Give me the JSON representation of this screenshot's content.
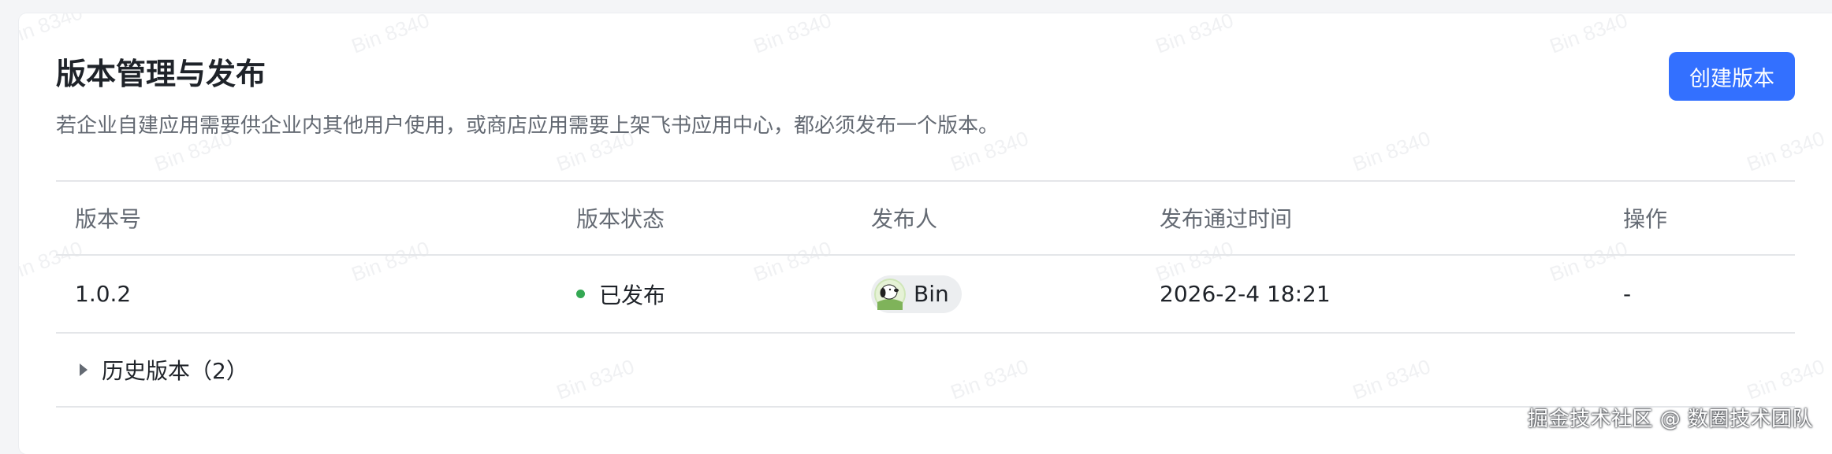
{
  "header": {
    "title": "版本管理与发布",
    "description": "若企业自建应用需要供企业内其他用户使用，或商店应用需要上架飞书应用中心，都必须发布一个版本。",
    "create_button_label": "创建版本",
    "accent_color": "#3370ff"
  },
  "table": {
    "columns": [
      "版本号",
      "版本状态",
      "发布人",
      "发布通过时间",
      "操作"
    ],
    "rows": [
      {
        "version": "1.0.2",
        "status": "已发布",
        "status_color": "#34a853",
        "publisher": "Bin",
        "publisher_avatar_icon": "snoopy-avatar-icon",
        "approved_time": "2026-2-4 18:21",
        "action": "-"
      }
    ],
    "history_label": "历史版本（2）"
  },
  "watermark_text": "Bin 8340",
  "footer_note": "掘金技术社区 @ 数圈技术团队"
}
